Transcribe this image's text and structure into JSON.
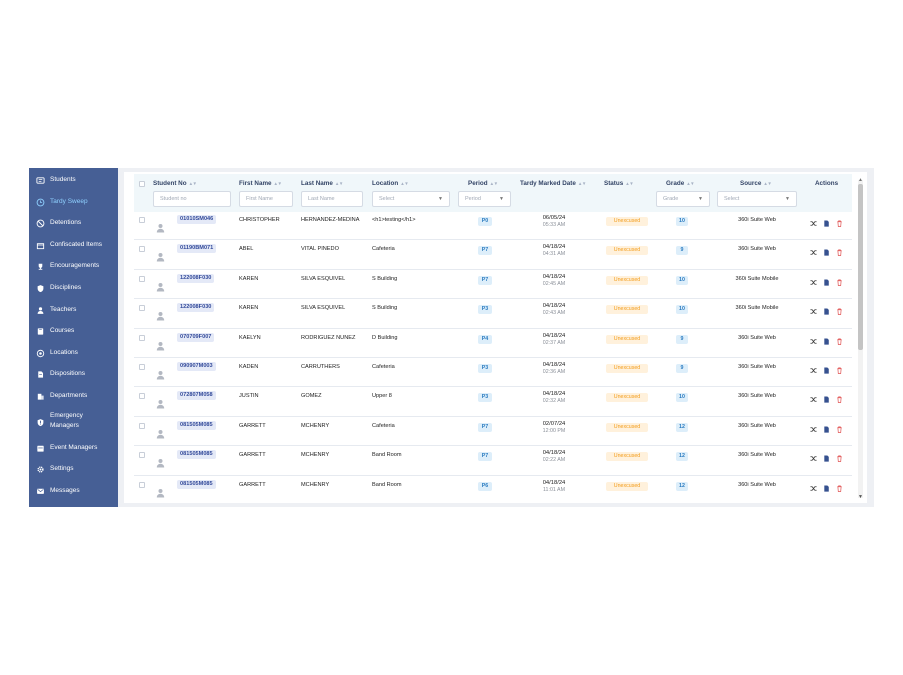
{
  "sidebar": {
    "items": [
      {
        "label": "Students",
        "icon": "id-card-icon",
        "active": false
      },
      {
        "label": "Tardy Sweep",
        "icon": "clock-icon",
        "active": true
      },
      {
        "label": "Detentions",
        "icon": "detention-icon",
        "active": false
      },
      {
        "label": "Confiscated Items",
        "icon": "box-icon",
        "active": false
      },
      {
        "label": "Encouragements",
        "icon": "trophy-icon",
        "active": false
      },
      {
        "label": "Disciplines",
        "icon": "shield-icon",
        "active": false
      },
      {
        "label": "Teachers",
        "icon": "person-icon",
        "active": false
      },
      {
        "label": "Courses",
        "icon": "book-icon",
        "active": false
      },
      {
        "label": "Locations",
        "icon": "location-icon",
        "active": false
      },
      {
        "label": "Dispositions",
        "icon": "file-icon",
        "active": false
      },
      {
        "label": "Departments",
        "icon": "building-icon",
        "active": false
      },
      {
        "label": "Emergency Managers",
        "icon": "shield-alert-icon",
        "active": false
      },
      {
        "label": "Event Managers",
        "icon": "calendar-icon",
        "active": false
      },
      {
        "label": "Settings",
        "icon": "gear-icon",
        "active": false
      },
      {
        "label": "Messages",
        "icon": "message-icon",
        "active": false
      }
    ]
  },
  "table": {
    "columns": {
      "student_no": "Student No",
      "first_name": "First Name",
      "last_name": "Last Name",
      "location": "Location",
      "period": "Period",
      "tardy_marked_date": "Tardy Marked Date",
      "status": "Status",
      "grade": "Grade",
      "source": "Source",
      "actions": "Actions"
    },
    "filters": {
      "student_no": "Student no",
      "first_name": "First Name",
      "last_name": "Last Name",
      "location": "Select",
      "period": "Period",
      "grade": "Grade",
      "source": "Select"
    },
    "rows": [
      {
        "student_no": "01010SM046",
        "first": "CHRISTOPHER",
        "last": "HERNANDEZ-MEDINA",
        "location": "<h1>testing</h1>",
        "period": "P0",
        "date": "06/05/24",
        "time": "05:33 AM",
        "status": "Unexcused",
        "grade": "10",
        "source": "360i Suite Web"
      },
      {
        "student_no": "01190BM071",
        "first": "ABEL",
        "last": "VITAL PINEDO",
        "location": "Cafeteria",
        "period": "P7",
        "date": "04/18/24",
        "time": "04:31 AM",
        "status": "Unexcused",
        "grade": "9",
        "source": "360i Suite Web"
      },
      {
        "student_no": "122008F030",
        "first": "KAREN",
        "last": "SILVA ESQUIVEL",
        "location": "S Building",
        "period": "P7",
        "date": "04/18/24",
        "time": "02:45 AM",
        "status": "Unexcused",
        "grade": "10",
        "source": "360i Suite Mobile"
      },
      {
        "student_no": "122008F030",
        "first": "KAREN",
        "last": "SILVA ESQUIVEL",
        "location": "S Building",
        "period": "P3",
        "date": "04/18/24",
        "time": "02:43 AM",
        "status": "Unexcused",
        "grade": "10",
        "source": "360i Suite Mobile"
      },
      {
        "student_no": "070709F007",
        "first": "KAELYN",
        "last": "RODRIGUEZ NUNEZ",
        "location": "D Building",
        "period": "P4",
        "date": "04/18/24",
        "time": "02:37 AM",
        "status": "Unexcused",
        "grade": "9",
        "source": "360i Suite Web"
      },
      {
        "student_no": "090907M003",
        "first": "KADEN",
        "last": "CARRUTHERS",
        "location": "Cafeteria",
        "period": "P3",
        "date": "04/18/24",
        "time": "02:36 AM",
        "status": "Unexcused",
        "grade": "9",
        "source": "360i Suite Web"
      },
      {
        "student_no": "072807M058",
        "first": "JUSTIN",
        "last": "GOMEZ",
        "location": "Upper 8",
        "period": "P3",
        "date": "04/18/24",
        "time": "02:32 AM",
        "status": "Unexcused",
        "grade": "10",
        "source": "360i Suite Web"
      },
      {
        "student_no": "081505M085",
        "first": "GARRETT",
        "last": "MCHENRY",
        "location": "Cafeteria",
        "period": "P7",
        "date": "02/07/24",
        "time": "12:00 PM",
        "status": "Unexcused",
        "grade": "12",
        "source": "360i Suite Web"
      },
      {
        "student_no": "081505M085",
        "first": "GARRETT",
        "last": "MCHENRY",
        "location": "Band Room",
        "period": "P7",
        "date": "04/18/24",
        "time": "02:22 AM",
        "status": "Unexcused",
        "grade": "12",
        "source": "360i Suite Web"
      },
      {
        "student_no": "081505M085",
        "first": "GARRETT",
        "last": "MCHENRY",
        "location": "Band Room",
        "period": "P6",
        "date": "04/18/24",
        "time": "11:01 AM",
        "status": "Unexcused",
        "grade": "12",
        "source": "360i Suite Web"
      }
    ]
  },
  "colors": {
    "sidebar_bg": "#465f95",
    "active_nav": "#8fd0ff",
    "status_unexcused": "#f39c19",
    "pill_blue": "#2a7bc0",
    "delete_red": "#e05050"
  }
}
